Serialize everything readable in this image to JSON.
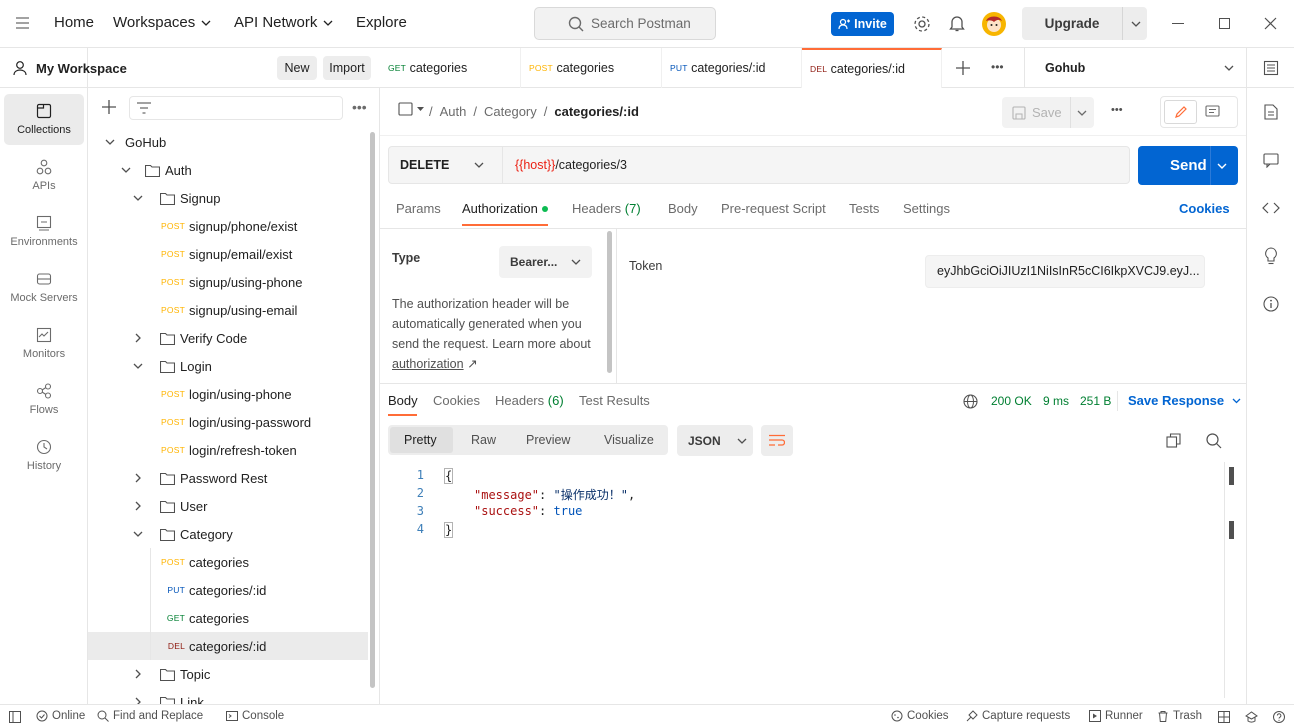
{
  "topbar": {
    "nav": [
      "Home",
      "Workspaces",
      "API Network",
      "Explore"
    ],
    "search_placeholder": "Search Postman",
    "invite_label": "Invite",
    "upgrade_label": "Upgrade"
  },
  "workspace": {
    "name": "My Workspace",
    "new_label": "New",
    "import_label": "Import"
  },
  "leftbar": [
    {
      "label": "Collections",
      "icon": "collections-icon"
    },
    {
      "label": "APIs",
      "icon": "apis-icon"
    },
    {
      "label": "Environments",
      "icon": "environments-icon"
    },
    {
      "label": "Mock Servers",
      "icon": "mock-servers-icon"
    },
    {
      "label": "Monitors",
      "icon": "monitors-icon"
    },
    {
      "label": "Flows",
      "icon": "flows-icon"
    },
    {
      "label": "History",
      "icon": "history-icon"
    }
  ],
  "tree": [
    {
      "label": "GoHub",
      "type": "collection",
      "depth": 0,
      "expanded": true
    },
    {
      "label": "Auth",
      "type": "folder",
      "depth": 1,
      "expanded": true
    },
    {
      "label": "Signup",
      "type": "folder",
      "depth": 2,
      "expanded": true
    },
    {
      "label": "signup/phone/exist",
      "type": "request",
      "method": "POST",
      "depth": 3
    },
    {
      "label": "signup/email/exist",
      "type": "request",
      "method": "POST",
      "depth": 3
    },
    {
      "label": "signup/using-phone",
      "type": "request",
      "method": "POST",
      "depth": 3
    },
    {
      "label": "signup/using-email",
      "type": "request",
      "method": "POST",
      "depth": 3
    },
    {
      "label": "Verify Code",
      "type": "folder",
      "depth": 2,
      "expanded": false
    },
    {
      "label": "Login",
      "type": "folder",
      "depth": 2,
      "expanded": true
    },
    {
      "label": "login/using-phone",
      "type": "request",
      "method": "POST",
      "depth": 3
    },
    {
      "label": "login/using-password",
      "type": "request",
      "method": "POST",
      "depth": 3
    },
    {
      "label": "login/refresh-token",
      "type": "request",
      "method": "POST",
      "depth": 3
    },
    {
      "label": "Password Rest",
      "type": "folder",
      "depth": 2,
      "expanded": false
    },
    {
      "label": "User",
      "type": "folder",
      "depth": 2,
      "expanded": false
    },
    {
      "label": "Category",
      "type": "folder",
      "depth": 2,
      "expanded": true
    },
    {
      "label": "categories",
      "type": "request",
      "method": "POST",
      "depth": 3
    },
    {
      "label": "categories/:id",
      "type": "request",
      "method": "PUT",
      "depth": 3
    },
    {
      "label": "categories",
      "type": "request",
      "method": "GET",
      "depth": 3
    },
    {
      "label": "categories/:id",
      "type": "request",
      "method": "DEL",
      "depth": 3,
      "selected": true
    },
    {
      "label": "Topic",
      "type": "folder",
      "depth": 2,
      "expanded": false
    },
    {
      "label": "Link",
      "type": "folder",
      "depth": 2,
      "expanded": false
    }
  ],
  "tabs": [
    {
      "method": "GET",
      "label": "categories"
    },
    {
      "method": "POST",
      "label": "categories"
    },
    {
      "method": "PUT",
      "label": "categories/:id"
    },
    {
      "method": "DEL",
      "label": "categories/:id",
      "active": true
    }
  ],
  "environment": "Gohub",
  "breadcrumb": [
    "Auth",
    "Category",
    "categories/:id"
  ],
  "save_label": "Save",
  "request": {
    "method": "DELETE",
    "url_var": "{{host}}",
    "url_path": "/categories/3",
    "send_label": "Send"
  },
  "request_tabs": [
    "Params",
    "Authorization",
    "Headers",
    "(7)",
    "Body",
    "Pre-request Script",
    "Tests",
    "Settings"
  ],
  "cookies_label": "Cookies",
  "auth": {
    "type_label": "Type",
    "type_value": "Bearer...",
    "description": "The authorization header will be automatically generated when you send the request. Learn more about",
    "link_text": "authorization",
    "link_arrow": "↗",
    "token_label": "Token",
    "token_value": "eyJhbGciOiJIUzI1NiIsInR5cCI6IkpXVCJ9.eyJ..."
  },
  "response": {
    "tabs": [
      "Body",
      "Cookies",
      "Headers",
      "(6)",
      "Test Results"
    ],
    "status": "200 OK",
    "time": "9 ms",
    "size": "251 B",
    "save_response_label": "Save Response",
    "view_modes": [
      "Pretty",
      "Raw",
      "Preview",
      "Visualize"
    ],
    "format": "JSON",
    "line_numbers": [
      "1",
      "2",
      "3",
      "4"
    ],
    "brace_open": "{",
    "brace_close": "}",
    "key_message": "\"message\"",
    "val_message": "\"操作成功！\"",
    "key_success": "\"success\"",
    "val_success": "true",
    "colon": ":",
    "comma": ","
  },
  "statusbar": {
    "online": "Online",
    "find_replace": "Find and Replace",
    "console": "Console",
    "cookies": "Cookies",
    "capture": "Capture requests",
    "runner": "Runner",
    "trash": "Trash"
  },
  "colors": {
    "accent": "#0265d2",
    "orange": "#ff6c37",
    "post": "#ffb400",
    "get": "#007f31",
    "put": "#0053b8",
    "delete": "#8e1a10",
    "status_ok": "#007f31"
  }
}
